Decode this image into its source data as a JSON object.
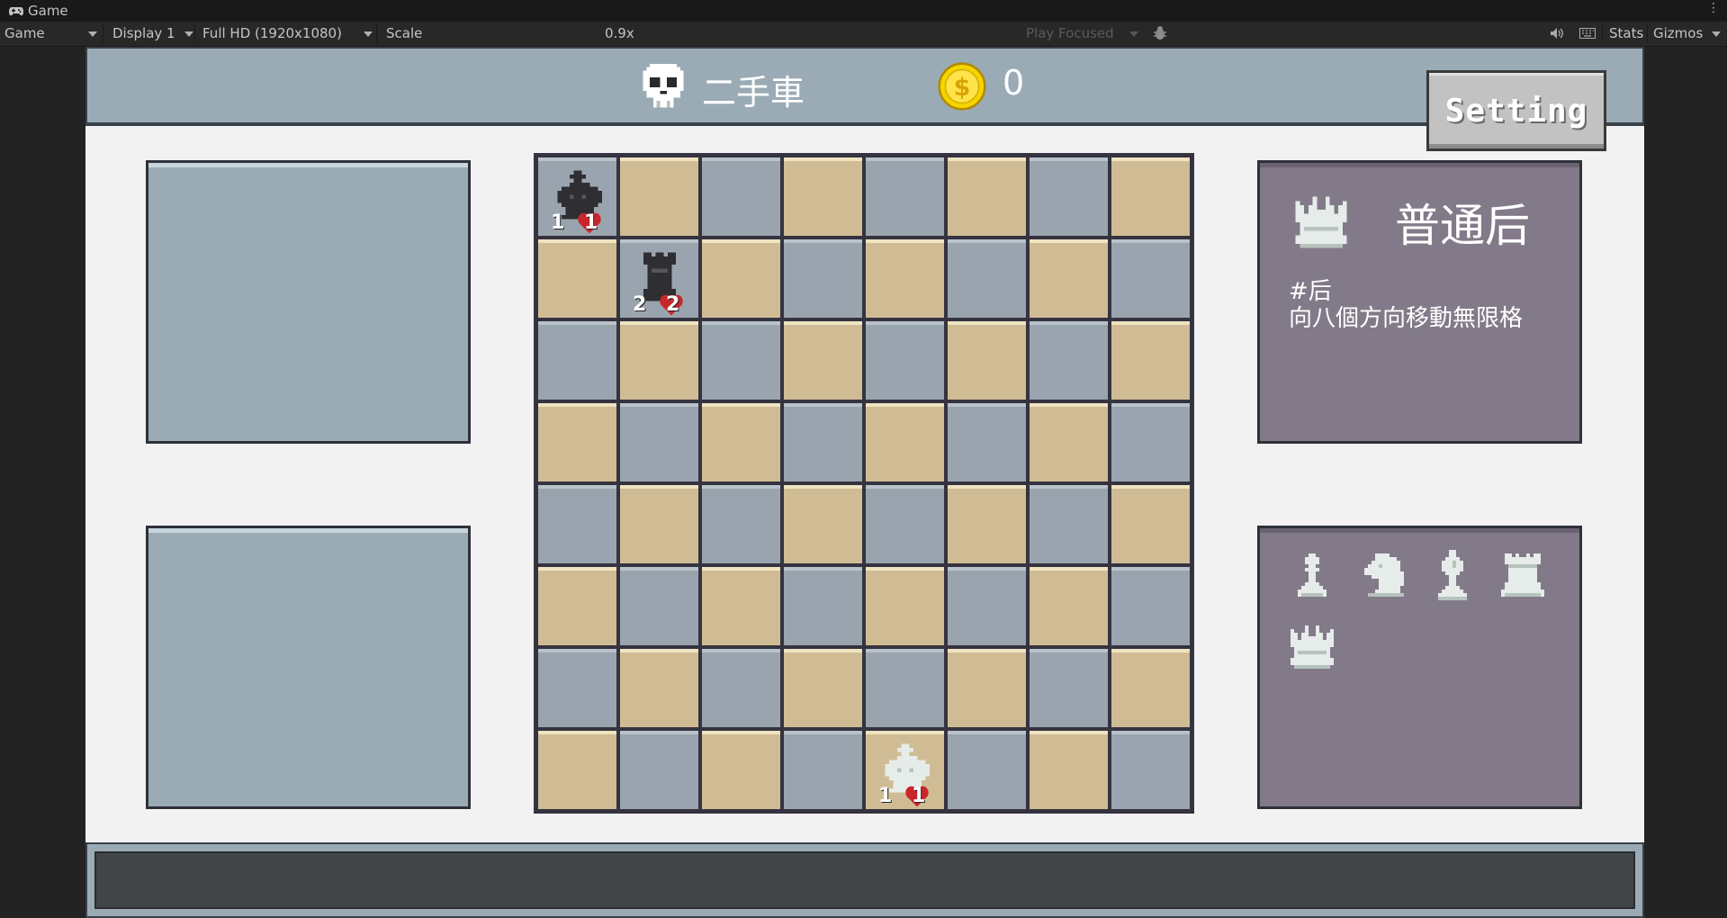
{
  "editor": {
    "tab_title": "Game",
    "display_mode": "Game",
    "display": "Display 1",
    "resolution": "Full HD (1920x1080)",
    "scale_label": "Scale",
    "scale_value": "0.9x",
    "play_mode": "Play Focused",
    "stats": "Stats",
    "gizmos": "Gizmos",
    "icons": [
      "gamepad-icon",
      "bug-icon",
      "speaker-icon",
      "keyboard-icon",
      "more-icon"
    ]
  },
  "header": {
    "enemy_name": "二手車",
    "coins": "0",
    "setting_label": "Setting"
  },
  "board": {
    "size": 8,
    "pieces": [
      {
        "row": 0,
        "col": 0,
        "type": "king",
        "color": "black",
        "attack": "1",
        "hp": "1"
      },
      {
        "row": 1,
        "col": 1,
        "type": "rook",
        "color": "black",
        "attack": "2",
        "hp": "2"
      },
      {
        "row": 7,
        "col": 4,
        "type": "king",
        "color": "white",
        "attack": "1",
        "hp": "1"
      }
    ]
  },
  "info": {
    "title": "普通后",
    "tag": "#后",
    "description": "向八個方向移動無限格",
    "icon": "queen-icon"
  },
  "inventory": {
    "items": [
      "pawn-icon",
      "knight-icon",
      "bishop-icon",
      "rook-icon",
      "queen-icon"
    ]
  },
  "colors": {
    "light_square": "#d0bc94",
    "dark_square": "#9aa4ae",
    "panel_blue": "#9aabb6",
    "panel_purple": "#837a89",
    "heart_red": "#c8262b",
    "coin_gold": "#f5d400"
  }
}
